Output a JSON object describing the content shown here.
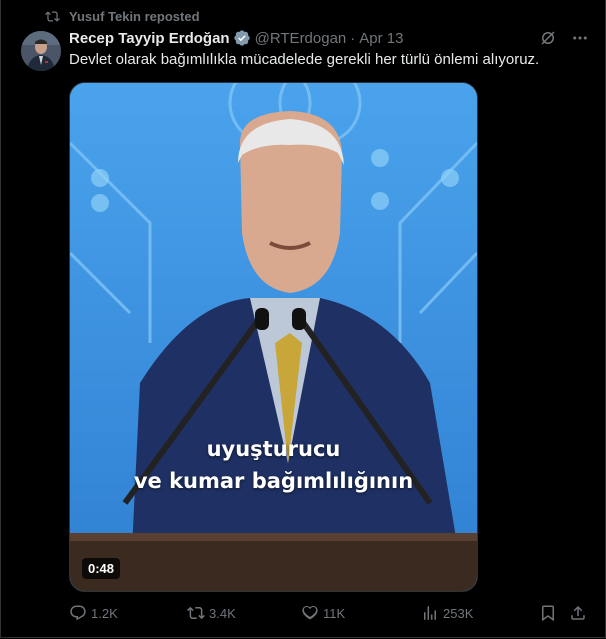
{
  "repost": {
    "text": "Yusuf Tekin reposted",
    "icon": "repost-icon"
  },
  "tweet": {
    "author_name": "Recep Tayyip Erdoğan",
    "handle": "@RTErdogan",
    "separator": "·",
    "date": "Apr 13",
    "text": "Devlet olarak bağımlılıkla mücadelede gerekli her türlü önlemi alıyoruz.",
    "verified_color": "#829aab"
  },
  "media": {
    "caption_line1": "uyuşturucu",
    "caption_line2": "ve kumar bağımlılığının",
    "duration": "0:48"
  },
  "actions": {
    "replies": "1.2K",
    "reposts": "3.4K",
    "likes": "11K",
    "views": "253K"
  },
  "colors": {
    "background": "#000000",
    "text": "#e7e9ea",
    "muted": "#71767b",
    "border": "#2f3336"
  }
}
